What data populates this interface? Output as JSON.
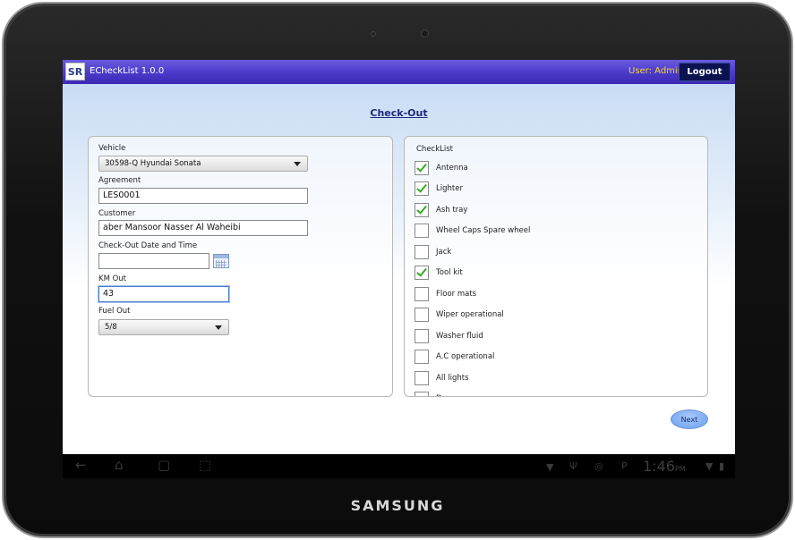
{
  "device": {
    "brand": "SAMSUNG"
  },
  "app": {
    "logo_text": "SR",
    "title": "ECheckList 1.0.0",
    "user_label": "User: Admin",
    "logout_label": "Logout"
  },
  "page": {
    "title": "Check-Out"
  },
  "form": {
    "vehicle_label": "Vehicle",
    "vehicle_value": "30598-Q Hyundai Sonata",
    "agreement_label": "Agreement",
    "agreement_value": "LES0001",
    "customer_label": "Customer",
    "customer_value": "aber Mansoor Nasser Al Waheibi",
    "checkout_datetime_label": "Check-Out Date and Time",
    "checkout_datetime_value": "",
    "km_out_label": "KM Out",
    "km_out_value": "43",
    "fuel_out_label": "Fuel Out",
    "fuel_out_value": "5/8"
  },
  "checklist": {
    "title": "CheckList",
    "items": [
      {
        "label": "Antenna",
        "checked": true
      },
      {
        "label": "Lighter",
        "checked": true
      },
      {
        "label": "Ash tray",
        "checked": true
      },
      {
        "label": "Wheel Caps Spare wheel",
        "checked": false
      },
      {
        "label": "Jack",
        "checked": false
      },
      {
        "label": "Tool kit",
        "checked": true
      },
      {
        "label": "Floor mats",
        "checked": false
      },
      {
        "label": "Wiper operational",
        "checked": false
      },
      {
        "label": "Washer fluid",
        "checked": false
      },
      {
        "label": "A.C operational",
        "checked": false
      },
      {
        "label": "All lights",
        "checked": false
      },
      {
        "label": "Doors",
        "checked": false
      }
    ]
  },
  "next_label": "Next",
  "navbar": {
    "icons": [
      "back-icon",
      "home-icon",
      "recent-apps-icon",
      "screenshot-icon"
    ],
    "time": "1:46",
    "ampm": "PM"
  },
  "colors": {
    "titlebar": "#4a39c8",
    "accent_check": "#3aaa28",
    "user_label": "#f5d33c",
    "page_title": "#1e2a7a"
  }
}
